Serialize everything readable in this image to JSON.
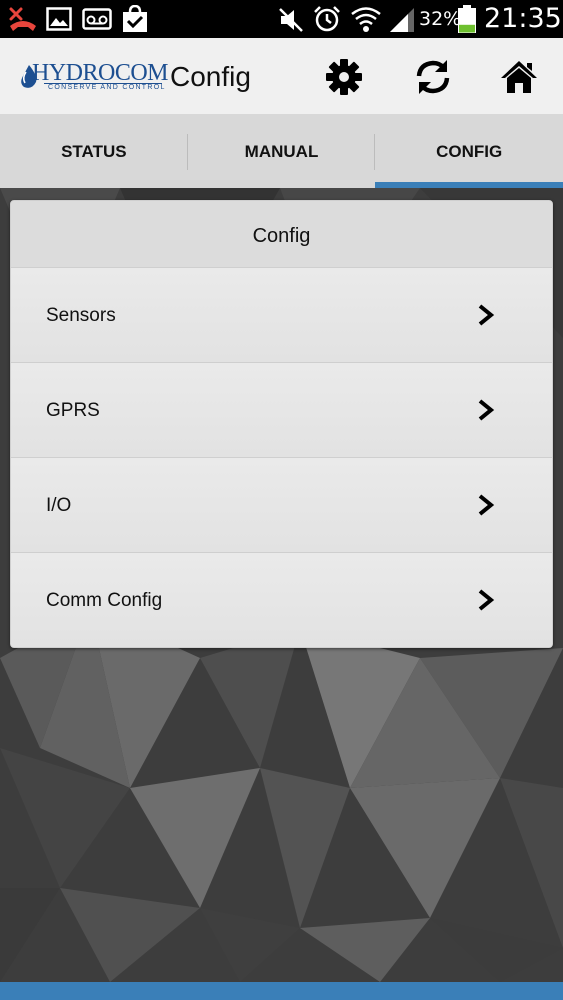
{
  "status_bar": {
    "battery_percent": "32%",
    "battery_level": 0.32,
    "time": "21:35",
    "icons": [
      "missed-call-icon",
      "gallery-icon",
      "voicemail-icon",
      "checklist-icon",
      "mute-icon",
      "alarm-icon",
      "wifi-icon",
      "signal-icon",
      "battery-icon"
    ]
  },
  "header": {
    "logo_text": "HYDROCOM",
    "logo_tagline": "CONSERVE AND CONTROL",
    "title": "Config",
    "buttons": [
      "gear-icon",
      "refresh-icon",
      "home-icon"
    ]
  },
  "tabs": [
    {
      "label": "STATUS",
      "active": false
    },
    {
      "label": "MANUAL",
      "active": false
    },
    {
      "label": "CONFIG",
      "active": true
    }
  ],
  "card": {
    "title": "Config",
    "items": [
      {
        "label": "Sensors"
      },
      {
        "label": "GPRS"
      },
      {
        "label": "I/O"
      },
      {
        "label": "Comm Config"
      }
    ]
  },
  "colors": {
    "accent": "#3a7fb8",
    "brand": "#1d4f91",
    "missed_call": "#e8453c",
    "battery_fill": "#6ec02f"
  }
}
